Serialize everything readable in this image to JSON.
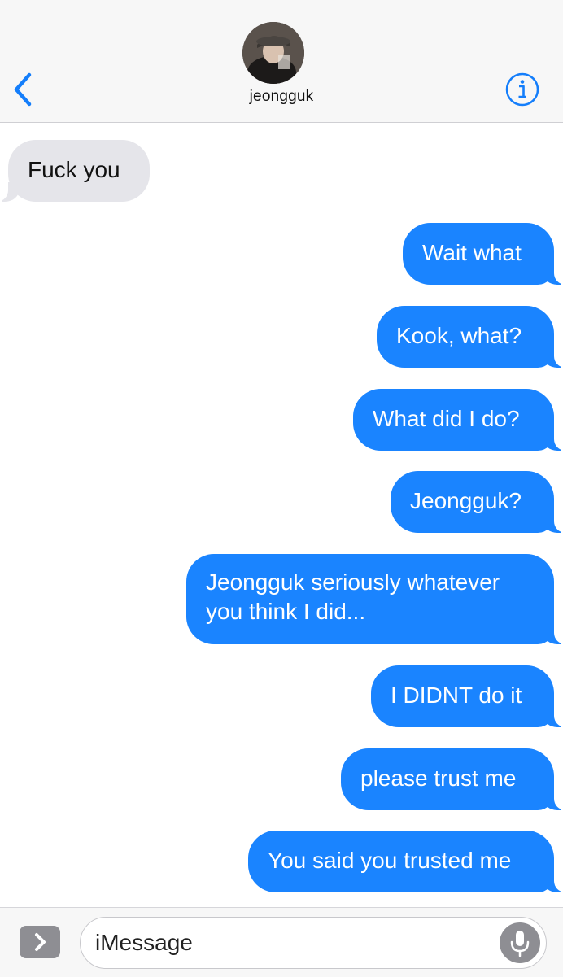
{
  "header": {
    "contact_name": "jeongguk",
    "back_icon": "chevron-left-icon",
    "info_icon": "info-circle-icon",
    "accent_color": "#147efb"
  },
  "messages": [
    {
      "direction": "incoming",
      "text": "Fuck you"
    },
    {
      "direction": "outgoing",
      "text": "Wait what"
    },
    {
      "direction": "outgoing",
      "text": "Kook, what?"
    },
    {
      "direction": "outgoing",
      "text": "What did I do?"
    },
    {
      "direction": "outgoing",
      "text": "Jeongguk?"
    },
    {
      "direction": "outgoing",
      "text": "Jeongguk seriously whatever you think I did..."
    },
    {
      "direction": "outgoing",
      "text": "I DIDNT do it"
    },
    {
      "direction": "outgoing",
      "text": "please trust me"
    },
    {
      "direction": "outgoing",
      "text": "You said you trusted me"
    }
  ],
  "colors": {
    "outgoing_bubble": "#1a84ff",
    "incoming_bubble": "#e5e5ea"
  },
  "input_bar": {
    "placeholder": "iMessage",
    "apps_icon": "app-drawer-chevron-icon",
    "mic_icon": "microphone-icon"
  }
}
